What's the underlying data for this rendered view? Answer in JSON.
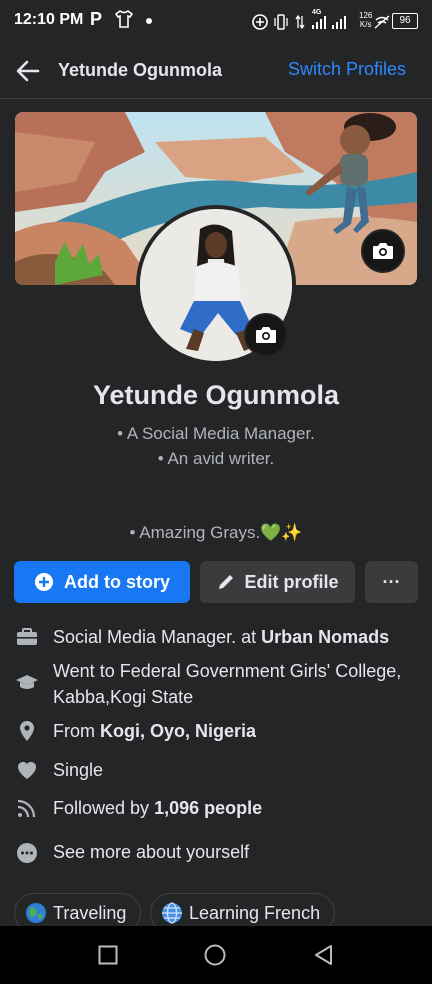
{
  "status_bar": {
    "time": "12:10 PM",
    "carrier_icon": "P",
    "network": "4G",
    "speed_value": "126",
    "speed_unit": "K/s",
    "battery": "96"
  },
  "header": {
    "title": "Yetunde Ogunmola",
    "switch_label": "Switch Profiles"
  },
  "profile": {
    "name": "Yetunde Ogunmola",
    "bio_lines": [
      "• A Social Media Manager.",
      "• An avid writer.",
      "• Amazing Grays.💚✨"
    ]
  },
  "buttons": {
    "add_story": "Add to story",
    "edit_profile": "Edit profile",
    "more": "···"
  },
  "details": {
    "work_prefix": "Social Media Manager. at ",
    "work_place": "Urban Nomads",
    "education": "Went to Federal Government Girls' College, Kabba,Kogi State",
    "from_prefix": "From ",
    "from_place": "Kogi, Oyo, Nigeria",
    "relationship": "Single",
    "followers_prefix": "Followed by ",
    "followers_count": "1,096 people",
    "see_more": "See more about yourself"
  },
  "hobbies": [
    {
      "label": "Traveling",
      "icon": "earth-globe-emoji"
    },
    {
      "label": "Learning French",
      "icon": "globe-meridians-emoji"
    }
  ],
  "colors": {
    "background": "#242526",
    "accent": "#1877f2",
    "link": "#2d88ff",
    "secondary_button": "#3a3b3c"
  }
}
